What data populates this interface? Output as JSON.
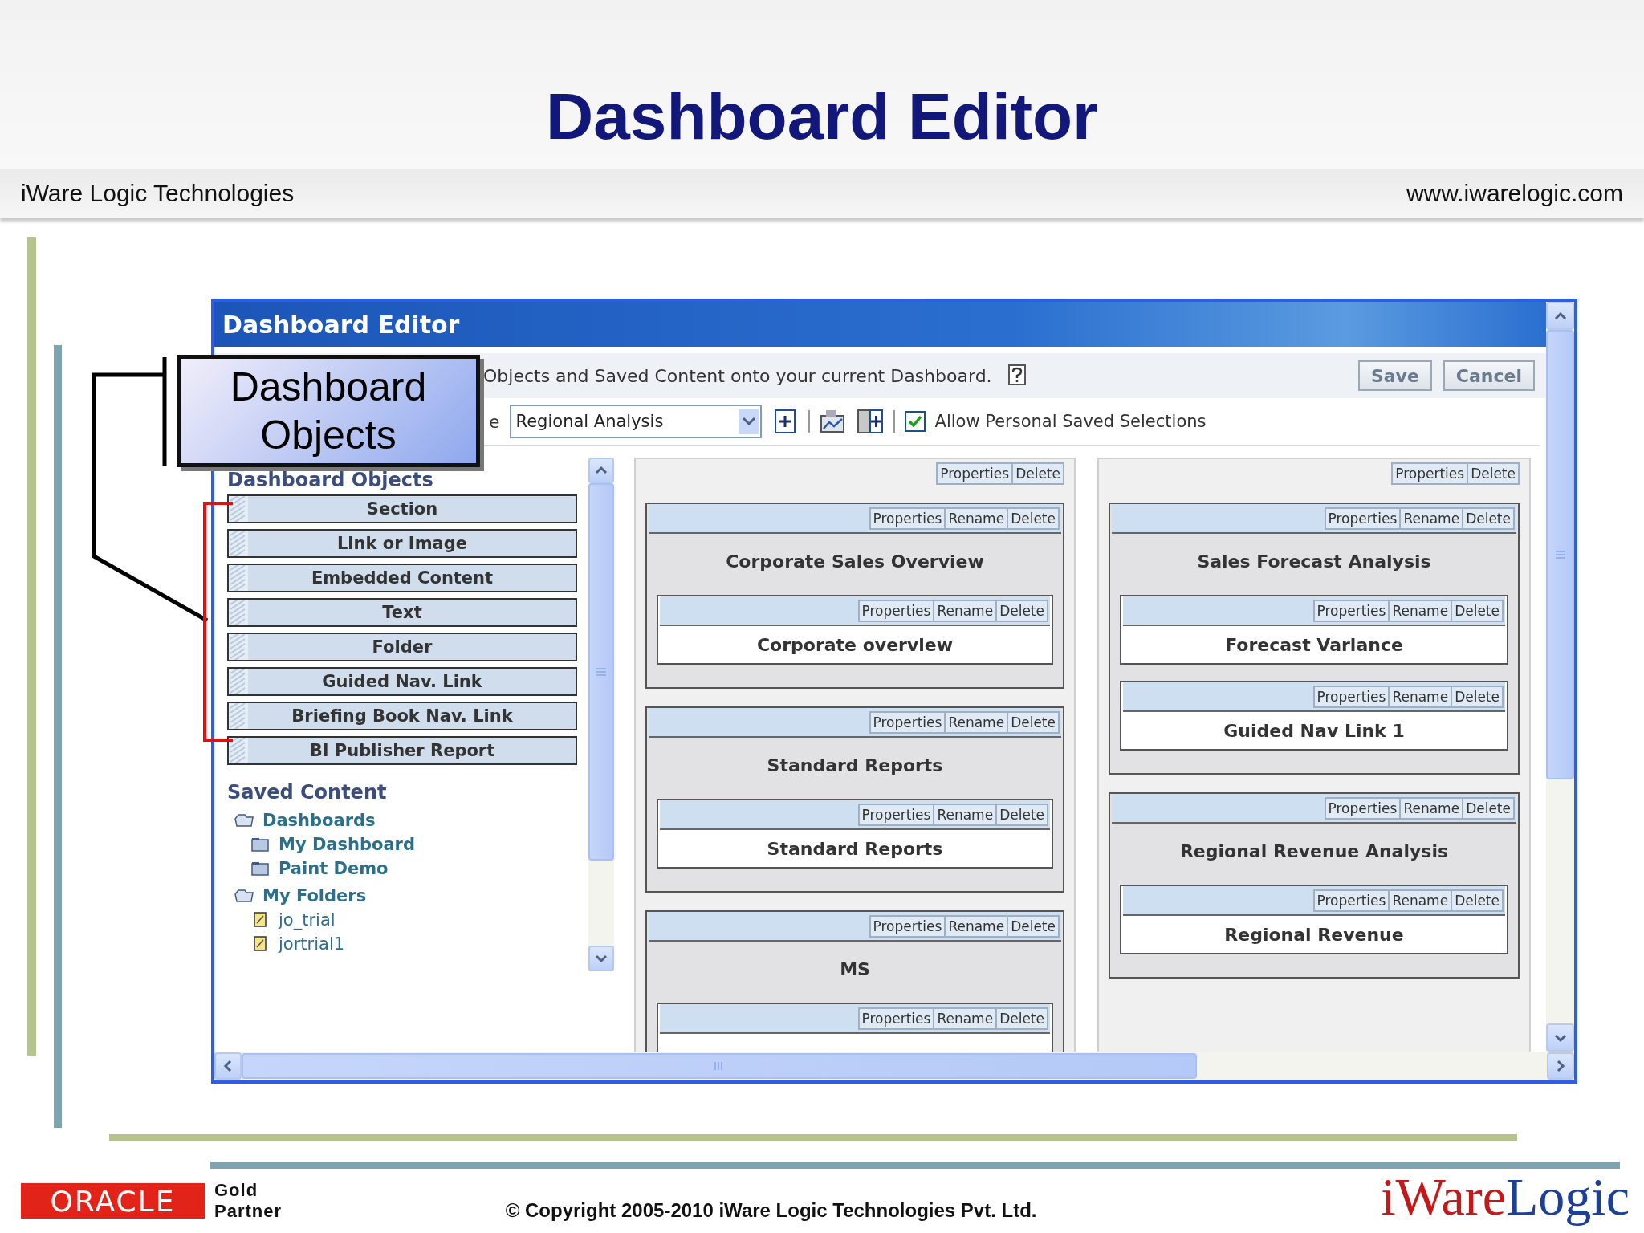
{
  "slide": {
    "title": "Dashboard Editor",
    "company": "iWare Logic Technologies",
    "website": "www.iwarelogic.com"
  },
  "callout": {
    "text": "Dashboard Objects"
  },
  "editor": {
    "title": "Dashboard Editor",
    "instruction": "Objects and Saved Content onto your current Dashboard.",
    "buttons": [
      "Save",
      "Cancel"
    ],
    "toolbar": {
      "label_fragment": "e",
      "dashboard_page": "Regional Analysis",
      "allow_personal_selections": {
        "label": "Allow Personal Saved Selections",
        "checked": true
      }
    },
    "objects_heading": "Dashboard Objects",
    "objects": [
      "Section",
      "Link or Image",
      "Embedded Content",
      "Text",
      "Folder",
      "Guided Nav. Link",
      "Briefing Book Nav. Link",
      "BI Publisher Report"
    ],
    "saved_content": {
      "heading": "Saved Content",
      "tree": [
        {
          "label": "Dashboards",
          "kind": "folder",
          "children": [
            {
              "label": "My Dashboard",
              "kind": "dashboard"
            },
            {
              "label": "Paint Demo",
              "kind": "dashboard"
            }
          ]
        },
        {
          "label": "My Folders",
          "kind": "folder",
          "children": [
            {
              "label": "jo_trial",
              "kind": "report"
            },
            {
              "label": "jortrial1",
              "kind": "report"
            }
          ]
        }
      ]
    },
    "columns": [
      {
        "buttons": [
          "Properties",
          "Delete"
        ],
        "sections": [
          {
            "title": "Corporate Sales Overview",
            "buttons": [
              "Properties",
              "Rename",
              "Delete"
            ],
            "items": [
              {
                "title": "Corporate overview",
                "buttons": [
                  "Properties",
                  "Rename",
                  "Delete"
                ]
              }
            ]
          },
          {
            "title": "Standard Reports",
            "buttons": [
              "Properties",
              "Rename",
              "Delete"
            ],
            "items": [
              {
                "title": "Standard Reports",
                "buttons": [
                  "Properties",
                  "Rename",
                  "Delete"
                ]
              }
            ]
          },
          {
            "title": "MS",
            "buttons": [
              "Properties",
              "Rename",
              "Delete"
            ],
            "items": [
              {
                "buttons": [
                  "Properties",
                  "Rename",
                  "Delete"
                ]
              }
            ]
          }
        ]
      },
      {
        "buttons": [
          "Properties",
          "Delete"
        ],
        "sections": [
          {
            "title": "Sales Forecast Analysis",
            "buttons": [
              "Properties",
              "Rename",
              "Delete"
            ],
            "items": [
              {
                "title": "Forecast Variance",
                "buttons": [
                  "Properties",
                  "Rename",
                  "Delete"
                ]
              },
              {
                "title": "Guided Nav Link 1",
                "buttons": [
                  "Properties",
                  "Rename",
                  "Delete"
                ]
              }
            ]
          },
          {
            "title": "Regional Revenue Analysis",
            "buttons": [
              "Properties",
              "Rename",
              "Delete"
            ],
            "items": [
              {
                "title": "Regional Revenue",
                "buttons": [
                  "Properties",
                  "Rename",
                  "Delete"
                ]
              }
            ]
          }
        ]
      }
    ]
  },
  "footer": {
    "oracle_logo": "ORACLE",
    "partner": [
      "Gold",
      "Partner"
    ],
    "copyright": "© Copyright 2005-2010 iWare Logic Technologies Pvt. Ltd.",
    "brand": [
      "iWare",
      "Logic"
    ]
  }
}
